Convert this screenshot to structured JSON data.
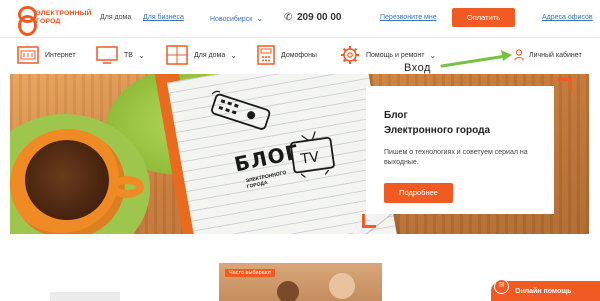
{
  "brand": {
    "line1": "ЭЛЕКТРОННЫЙ",
    "line2": "ГОРОД",
    "accent": "#f15a22"
  },
  "topbar": {
    "for_home": "Для дома",
    "for_business": "Для бизнеса",
    "city": "Новосибирск",
    "phone_icon": "phone-icon",
    "phone": "209 00 00",
    "callback": "Перезвоните мне",
    "pay_button": "Оплатить",
    "offices": "Адреса офисов"
  },
  "nav": {
    "items": [
      {
        "label": "Интернет",
        "icon": "internet-icon"
      },
      {
        "label": "ТВ",
        "icon": "tv-icon"
      },
      {
        "label": "Для дома",
        "icon": "home-icon"
      },
      {
        "label": "Домофоны",
        "icon": "intercom-icon"
      },
      {
        "label": "Помощь и ремонт",
        "icon": "gear-icon"
      }
    ],
    "account": "Личный кабинет"
  },
  "annotation": {
    "enter": "Вход"
  },
  "hero": {
    "doodle_word": "БЛОГ",
    "doodle_logo_line1": "ЭЛЕКТРОННОГО",
    "doodle_logo_line2": "ГОРОДА",
    "tv_text": "TV",
    "title_line1": "Блог",
    "title_line2": "Электронного города",
    "text": "Пишем о технологиях и советуем сериал на выходные.",
    "button": "Подробнее"
  },
  "teaser": {
    "badge": "Часто выбирают"
  },
  "help": {
    "label": "Онлайн помощь"
  }
}
